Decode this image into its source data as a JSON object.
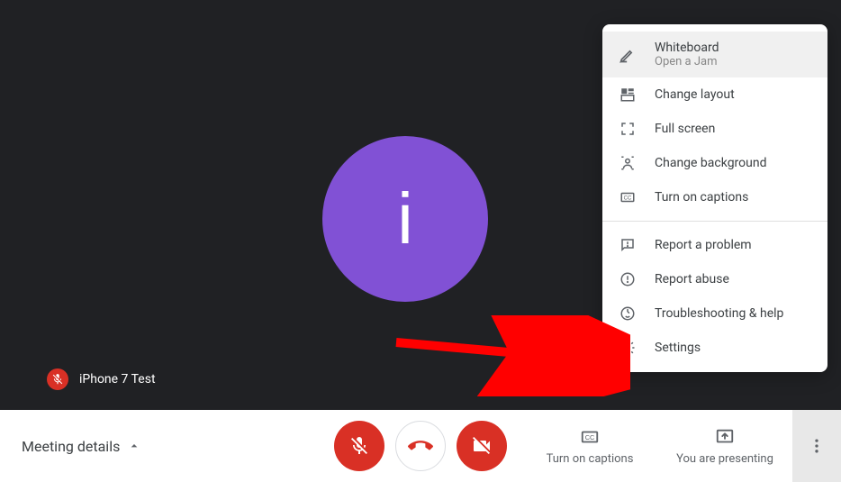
{
  "avatar": {
    "letter": "i"
  },
  "participant": {
    "name": "iPhone 7 Test"
  },
  "bottomBar": {
    "meetingDetails": "Meeting details",
    "captions": "Turn on captions",
    "presenting": "You are presenting"
  },
  "menu": {
    "whiteboard": {
      "title": "Whiteboard",
      "sub": "Open a Jam"
    },
    "changeLayout": "Change layout",
    "fullScreen": "Full screen",
    "changeBackground": "Change background",
    "turnOnCaptions": "Turn on captions",
    "reportProblem": "Report a problem",
    "reportAbuse": "Report abuse",
    "troubleshooting": "Troubleshooting & help",
    "settings": "Settings"
  }
}
